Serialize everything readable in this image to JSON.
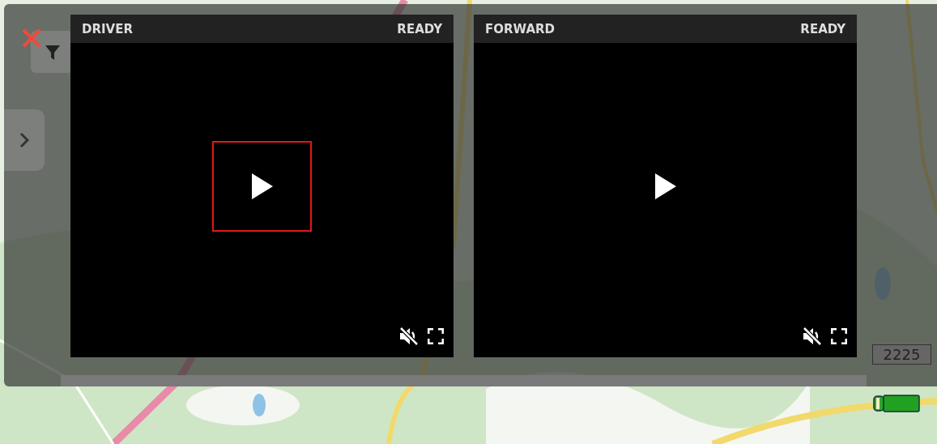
{
  "panels": [
    {
      "camera": "DRIVER",
      "status": "READY",
      "highlighted": true,
      "muted": true
    },
    {
      "camera": "FORWARD",
      "status": "READY",
      "highlighted": false,
      "muted": true
    }
  ],
  "vehicle": {
    "label": "2225"
  }
}
